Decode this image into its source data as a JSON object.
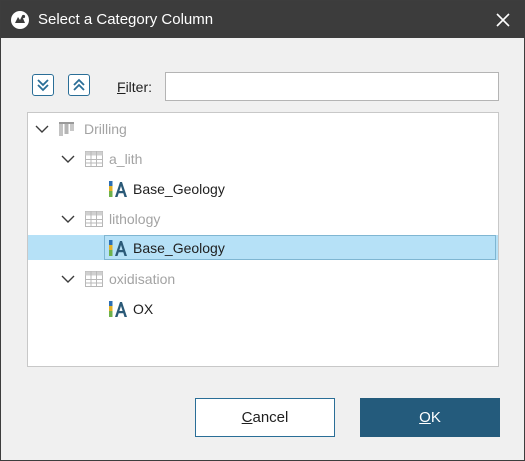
{
  "window": {
    "title": "Select a Category Column",
    "close_icon": "close-icon",
    "app_icon": "leapfrog-app-icon"
  },
  "toolbar": {
    "expand_all_icon": "double-chevron-down-icon",
    "collapse_all_icon": "double-chevron-up-icon",
    "filter_label_mnemonic": "F",
    "filter_label_rest": "ilter:",
    "filter_value": "",
    "filter_placeholder": ""
  },
  "tree": {
    "items": [
      {
        "label": "Drilling",
        "type": "drillhole-database",
        "icon": "drillhole-database-icon",
        "expanded": true,
        "enabled": false,
        "selected": false
      },
      {
        "label": "a_lith",
        "type": "table",
        "icon": "table-icon",
        "expanded": true,
        "enabled": false,
        "selected": false
      },
      {
        "label": "Base_Geology",
        "type": "category-column",
        "icon": "category-column-icon",
        "enabled": true,
        "selected": false
      },
      {
        "label": "lithology",
        "type": "table",
        "icon": "table-icon",
        "expanded": true,
        "enabled": false,
        "selected": false
      },
      {
        "label": "Base_Geology",
        "type": "category-column",
        "icon": "category-column-icon",
        "enabled": true,
        "selected": true
      },
      {
        "label": "oxidisation",
        "type": "table",
        "icon": "table-icon",
        "expanded": true,
        "enabled": false,
        "selected": false
      },
      {
        "label": "OX",
        "type": "category-column",
        "icon": "category-column-icon",
        "enabled": true,
        "selected": false
      }
    ]
  },
  "buttons": {
    "cancel_mnemonic": "C",
    "cancel_rest": "ancel",
    "ok_mnemonic": "O",
    "ok_rest": "K"
  },
  "colors": {
    "titlebar": "#3c3c3c",
    "selection": "#b6e1f7",
    "ok_button": "#245b7c",
    "accent_border": "#2a6e97"
  }
}
